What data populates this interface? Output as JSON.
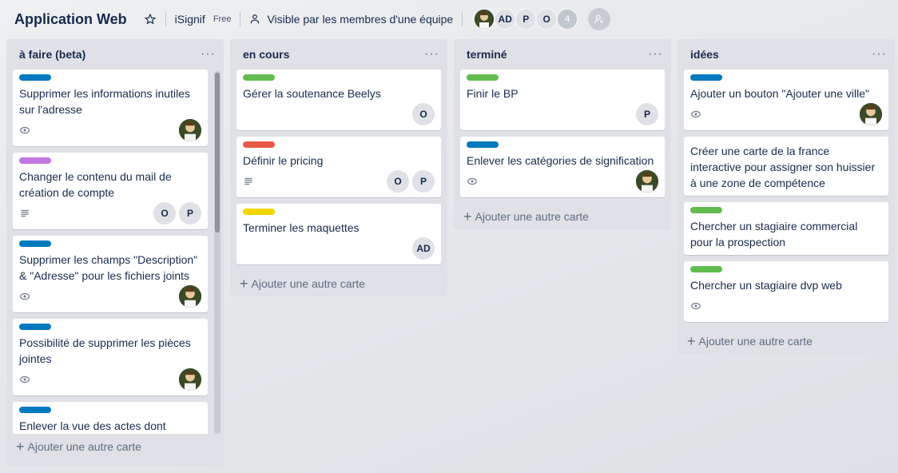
{
  "header": {
    "title": "Application Web",
    "team": "iSignif",
    "plan": "Free",
    "visibility": "Visible par les membres d'une équipe",
    "members": [
      "AD",
      "P",
      "O"
    ],
    "member_overflow": "4"
  },
  "add_card_label": "Ajouter une autre carte",
  "lists": [
    {
      "title": "à faire (beta)",
      "cards": [
        {
          "title": "Supprimer les informations inutiles sur l'adresse",
          "label": "blue"
        },
        {
          "title": "Changer le contenu du mail de création de compte",
          "label": "purple",
          "members": [
            "O",
            "P"
          ]
        },
        {
          "title": "Supprimer les champs \"Description\" & \"Adresse\" pour les fichiers joints",
          "label": "blue"
        },
        {
          "title": "Possibilité de supprimer les pièces jointes",
          "label": "blue"
        },
        {
          "title": "Enlever la vue des actes dont",
          "label": "blue"
        }
      ]
    },
    {
      "title": "en cours",
      "cards": [
        {
          "title": "Gérer la soutenance Beelys",
          "label": "green",
          "members": [
            "O"
          ]
        },
        {
          "title": "Définir le pricing",
          "label": "red",
          "members": [
            "O",
            "P"
          ]
        },
        {
          "title": "Terminer les maquettes",
          "label": "yellow",
          "members": [
            "AD"
          ]
        }
      ]
    },
    {
      "title": "terminé",
      "cards": [
        {
          "title": "Finir le BP",
          "label": "green",
          "members": [
            "P"
          ]
        },
        {
          "title": "Enlever les catégories de signification",
          "label": "blue"
        }
      ]
    },
    {
      "title": "idées",
      "cards": [
        {
          "title": "Ajouter un bouton \"Ajouter une ville\"",
          "label": "blue"
        },
        {
          "title": "Créer une carte de la france interactive pour assigner son huissier à une zone de compétence"
        },
        {
          "title": "Chercher un stagiaire commercial pour la prospection",
          "label": "green"
        },
        {
          "title": "Chercher un stagiaire dvp web",
          "label": "green"
        }
      ]
    }
  ],
  "label_colors": {
    "green": "#61bd4f",
    "blue": "#0079bf",
    "purple": "#c377e0",
    "red": "#eb5a46",
    "yellow": "#f2d600"
  }
}
